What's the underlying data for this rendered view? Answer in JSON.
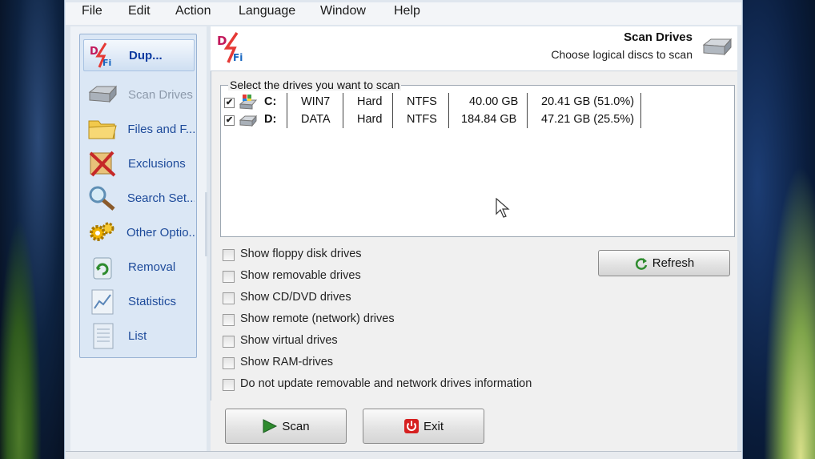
{
  "menu": {
    "file": "File",
    "edit": "Edit",
    "action": "Action",
    "language": "Language",
    "window": "Window",
    "help": "Help"
  },
  "sidebar": {
    "items": [
      {
        "label": "Dup...",
        "icon": "app-logo-icon"
      },
      {
        "label": "Scan Drives",
        "icon": "hard-drive-icon"
      },
      {
        "label": "Files and F...",
        "icon": "folder-icon"
      },
      {
        "label": "Exclusions",
        "icon": "x-mark-icon"
      },
      {
        "label": "Search Set...",
        "icon": "magnifier-icon"
      },
      {
        "label": "Other Optio...",
        "icon": "gears-icon"
      },
      {
        "label": "Removal",
        "icon": "recycle-icon"
      },
      {
        "label": "Statistics",
        "icon": "chart-icon"
      },
      {
        "label": "List",
        "icon": "list-icon"
      }
    ]
  },
  "header": {
    "title": "Scan Drives",
    "subtitle": "Choose logical discs to scan"
  },
  "drives": {
    "legend": "Select the drives you want to scan",
    "rows": [
      {
        "checked": true,
        "letter": "C:",
        "label": "WIN7",
        "type": "Hard",
        "fs": "NTFS",
        "size": "40.00 GB",
        "free": "20.41 GB (51.0%)"
      },
      {
        "checked": true,
        "letter": "D:",
        "label": "DATA",
        "type": "Hard",
        "fs": "NTFS",
        "size": "184.84 GB",
        "free": "47.21 GB (25.5%)"
      }
    ]
  },
  "options": [
    "Show floppy disk drives",
    "Show removable drives",
    "Show CD/DVD drives",
    "Show remote (network) drives",
    "Show virtual drives",
    "Show RAM-drives",
    "Do not update removable and network drives information"
  ],
  "buttons": {
    "refresh": "Refresh",
    "scan": "Scan",
    "exit": "Exit"
  },
  "colors": {
    "accent": "#1d4a9a",
    "sidebar_bg": "#dbe7f5",
    "scan_icon": "#2e8b2e",
    "exit_icon": "#d62020"
  }
}
